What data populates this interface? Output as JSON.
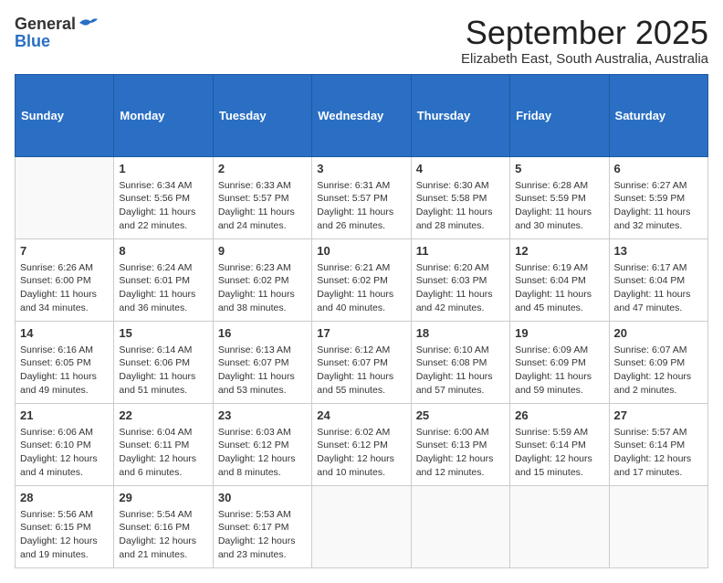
{
  "logo": {
    "general": "General",
    "blue": "Blue"
  },
  "title": {
    "month": "September 2025",
    "location": "Elizabeth East, South Australia, Australia"
  },
  "headers": [
    "Sunday",
    "Monday",
    "Tuesday",
    "Wednesday",
    "Thursday",
    "Friday",
    "Saturday"
  ],
  "weeks": [
    [
      {
        "day": "",
        "data": ""
      },
      {
        "day": "1",
        "data": "Sunrise: 6:34 AM\nSunset: 5:56 PM\nDaylight: 11 hours\nand 22 minutes."
      },
      {
        "day": "2",
        "data": "Sunrise: 6:33 AM\nSunset: 5:57 PM\nDaylight: 11 hours\nand 24 minutes."
      },
      {
        "day": "3",
        "data": "Sunrise: 6:31 AM\nSunset: 5:57 PM\nDaylight: 11 hours\nand 26 minutes."
      },
      {
        "day": "4",
        "data": "Sunrise: 6:30 AM\nSunset: 5:58 PM\nDaylight: 11 hours\nand 28 minutes."
      },
      {
        "day": "5",
        "data": "Sunrise: 6:28 AM\nSunset: 5:59 PM\nDaylight: 11 hours\nand 30 minutes."
      },
      {
        "day": "6",
        "data": "Sunrise: 6:27 AM\nSunset: 5:59 PM\nDaylight: 11 hours\nand 32 minutes."
      }
    ],
    [
      {
        "day": "7",
        "data": "Sunrise: 6:26 AM\nSunset: 6:00 PM\nDaylight: 11 hours\nand 34 minutes."
      },
      {
        "day": "8",
        "data": "Sunrise: 6:24 AM\nSunset: 6:01 PM\nDaylight: 11 hours\nand 36 minutes."
      },
      {
        "day": "9",
        "data": "Sunrise: 6:23 AM\nSunset: 6:02 PM\nDaylight: 11 hours\nand 38 minutes."
      },
      {
        "day": "10",
        "data": "Sunrise: 6:21 AM\nSunset: 6:02 PM\nDaylight: 11 hours\nand 40 minutes."
      },
      {
        "day": "11",
        "data": "Sunrise: 6:20 AM\nSunset: 6:03 PM\nDaylight: 11 hours\nand 42 minutes."
      },
      {
        "day": "12",
        "data": "Sunrise: 6:19 AM\nSunset: 6:04 PM\nDaylight: 11 hours\nand 45 minutes."
      },
      {
        "day": "13",
        "data": "Sunrise: 6:17 AM\nSunset: 6:04 PM\nDaylight: 11 hours\nand 47 minutes."
      }
    ],
    [
      {
        "day": "14",
        "data": "Sunrise: 6:16 AM\nSunset: 6:05 PM\nDaylight: 11 hours\nand 49 minutes."
      },
      {
        "day": "15",
        "data": "Sunrise: 6:14 AM\nSunset: 6:06 PM\nDaylight: 11 hours\nand 51 minutes."
      },
      {
        "day": "16",
        "data": "Sunrise: 6:13 AM\nSunset: 6:07 PM\nDaylight: 11 hours\nand 53 minutes."
      },
      {
        "day": "17",
        "data": "Sunrise: 6:12 AM\nSunset: 6:07 PM\nDaylight: 11 hours\nand 55 minutes."
      },
      {
        "day": "18",
        "data": "Sunrise: 6:10 AM\nSunset: 6:08 PM\nDaylight: 11 hours\nand 57 minutes."
      },
      {
        "day": "19",
        "data": "Sunrise: 6:09 AM\nSunset: 6:09 PM\nDaylight: 11 hours\nand 59 minutes."
      },
      {
        "day": "20",
        "data": "Sunrise: 6:07 AM\nSunset: 6:09 PM\nDaylight: 12 hours\nand 2 minutes."
      }
    ],
    [
      {
        "day": "21",
        "data": "Sunrise: 6:06 AM\nSunset: 6:10 PM\nDaylight: 12 hours\nand 4 minutes."
      },
      {
        "day": "22",
        "data": "Sunrise: 6:04 AM\nSunset: 6:11 PM\nDaylight: 12 hours\nand 6 minutes."
      },
      {
        "day": "23",
        "data": "Sunrise: 6:03 AM\nSunset: 6:12 PM\nDaylight: 12 hours\nand 8 minutes."
      },
      {
        "day": "24",
        "data": "Sunrise: 6:02 AM\nSunset: 6:12 PM\nDaylight: 12 hours\nand 10 minutes."
      },
      {
        "day": "25",
        "data": "Sunrise: 6:00 AM\nSunset: 6:13 PM\nDaylight: 12 hours\nand 12 minutes."
      },
      {
        "day": "26",
        "data": "Sunrise: 5:59 AM\nSunset: 6:14 PM\nDaylight: 12 hours\nand 15 minutes."
      },
      {
        "day": "27",
        "data": "Sunrise: 5:57 AM\nSunset: 6:14 PM\nDaylight: 12 hours\nand 17 minutes."
      }
    ],
    [
      {
        "day": "28",
        "data": "Sunrise: 5:56 AM\nSunset: 6:15 PM\nDaylight: 12 hours\nand 19 minutes."
      },
      {
        "day": "29",
        "data": "Sunrise: 5:54 AM\nSunset: 6:16 PM\nDaylight: 12 hours\nand 21 minutes."
      },
      {
        "day": "30",
        "data": "Sunrise: 5:53 AM\nSunset: 6:17 PM\nDaylight: 12 hours\nand 23 minutes."
      },
      {
        "day": "",
        "data": ""
      },
      {
        "day": "",
        "data": ""
      },
      {
        "day": "",
        "data": ""
      },
      {
        "day": "",
        "data": ""
      }
    ]
  ]
}
